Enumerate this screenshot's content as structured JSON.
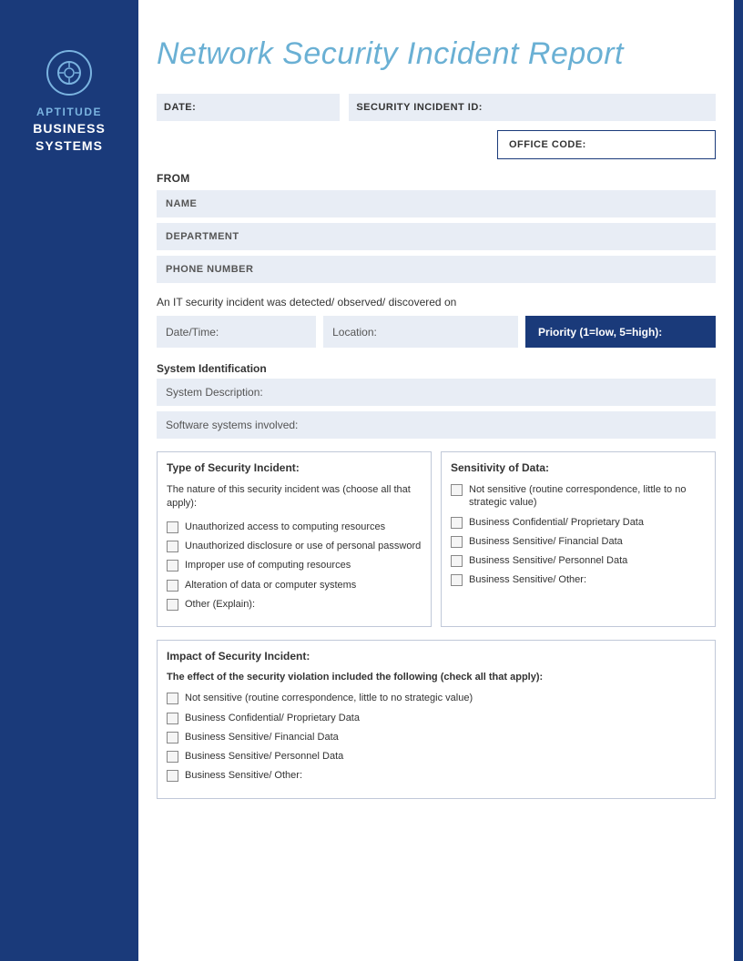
{
  "sidebar": {
    "company_line1": "APTITUDE",
    "company_line2": "BUSINESS",
    "company_line3": "SYSTEMS"
  },
  "header": {
    "title": "Network Security Incident Report"
  },
  "form": {
    "date_label": "DATE:",
    "incident_id_label": "SECURITY INCIDENT ID:",
    "office_code_label": "OFFICE CODE:",
    "from_label": "FROM",
    "name_label": "NAME",
    "department_label": "DEPARTMENT",
    "phone_label": "PHONE NUMBER",
    "detected_text": "An IT security incident was detected/ observed/ discovered on",
    "datetime_label": "Date/Time:",
    "location_label": "Location:",
    "priority_label": "Priority (1=low, 5=high):",
    "system_identification_label": "System Identification",
    "system_description_label": "System Description:",
    "software_label": "Software systems involved:",
    "incident_type_title": "Type of Security Incident:",
    "sensitivity_title": "Sensitivity of Data:",
    "nature_text": "The nature of this security incident was (choose all that apply):",
    "incident_checkboxes": [
      "Unauthorized access to computing resources",
      "Unauthorized disclosure or use of personal password",
      "Improper use of computing resources",
      "Alteration of data or computer systems",
      "Other (Explain):"
    ],
    "sensitivity_checkboxes": [
      "Not sensitive (routine correspondence, little to no strategic value)",
      "Business Confidential/ Proprietary Data",
      "Business Sensitive/ Financial Data",
      "Business Sensitive/ Personnel Data",
      "Business Sensitive/ Other:"
    ],
    "impact_title": "Impact of Security Incident:",
    "effect_text": "The effect of the security violation included the following (check all that apply):",
    "impact_checkboxes": [
      "Not sensitive (routine correspondence, little to no strategic value)",
      "Business Confidential/ Proprietary Data",
      "Business Sensitive/ Financial Data",
      "Business Sensitive/ Personnel Data",
      "Business Sensitive/ Other:"
    ]
  },
  "colors": {
    "sidebar_bg": "#1a3a7a",
    "accent_blue": "#6ab0d4",
    "field_bg": "#e8edf5",
    "priority_bg": "#1a3a7a"
  }
}
